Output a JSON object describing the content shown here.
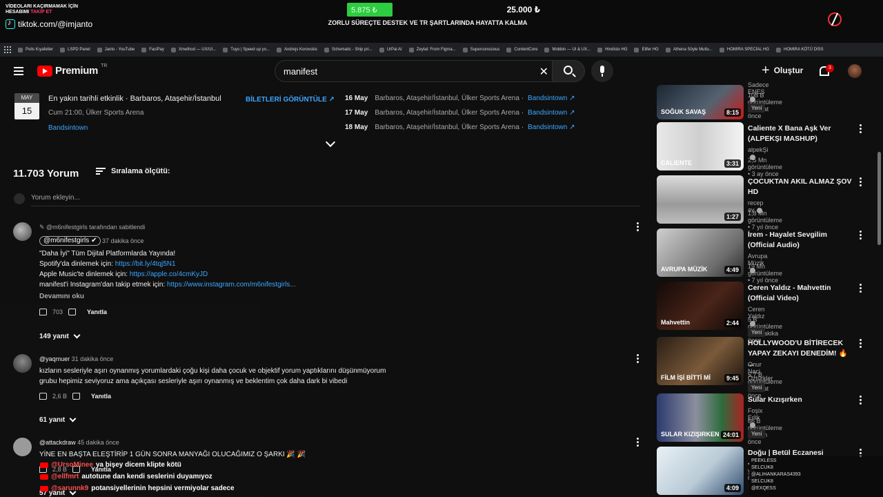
{
  "overlay": {
    "tiktok_line1": "VİDEOLARI KAÇIRMAMAK İÇİN",
    "tiktok_line2a": "HESABIMI",
    "tiktok_line2b": "TAKİP ET",
    "tiktok_handle": "tiktok.com/@imjanto",
    "donation_current": "5.875 ₺",
    "donation_goal": "25.000 ₺",
    "donation_progress": 0.235,
    "caption": "ZORLU SÜREÇTE DESTEK VE TR ŞARTLARINDA HAYATTA KALMA",
    "accent_color": "#2ecc40"
  },
  "bookmarks": [
    "Polis Kıyafetler",
    "LSPD Panel",
    "Janto - YouTube",
    "FaciPay",
    "Xmethod — UX/UI...",
    "Tuyo | Speed up yo...",
    "Andrejs Korovskis",
    "Schematic - Ship pri...",
    "UrPal AI",
    "Zeytal: From Figma...",
    "Superconscious",
    "ContentCore",
    "Mobbin — UI & UX...",
    "Hindisto HG",
    "Elifer HG",
    "Athena Söyle Mutlu...",
    "HOMIRA SPECİAL HG",
    "HOMIRA KÖTÜ DİSS"
  ],
  "header": {
    "logo_text": "Premium",
    "logo_suffix": "TR",
    "search_value": "manifest",
    "create_label": "Oluştur",
    "notification_count": "3"
  },
  "events": {
    "month": "MAY",
    "day": "15",
    "title": "En yakın tarihli etkinlik · Barbaros, Ataşehir/İstanbul",
    "subtitle": "Cum 21:00, Ülker Sports Arena",
    "source": "Bandsintown",
    "tickets_label": "BİLETLERİ GÖRÜNTÜLE ↗",
    "rows": [
      {
        "date": "16 May",
        "location": "Barbaros, Ataşehir/İstanbul, Ülker Sports Arena ·",
        "source": "Bandsintown ↗"
      },
      {
        "date": "17 May",
        "location": "Barbaros, Ataşehir/İstanbul, Ülker Sports Arena ·",
        "source": "Bandsintown ↗"
      },
      {
        "date": "18 May",
        "location": "Barbaros, Ataşehir/İstanbul, Ülker Sports Arena ·",
        "source": "Bandsintown ↗"
      }
    ]
  },
  "comments_header": {
    "count": "11.703 Yorum",
    "sort_label": "Sıralama ölçütü:",
    "add_placeholder": "Yorum ekleyin..."
  },
  "comments": {
    "pinned_by": "@m6nifestgirls tarafından sabitlendi",
    "c1": {
      "author": "@m6nifestgirls",
      "time": "37 dakika önce",
      "line1": "\"Daha İyi\" Tüm Dijital Platformlarda Yayında!",
      "line2_label": "Spotify'da dinlemek için: ",
      "line2_link": "https://bit.ly/4tqj5N1",
      "line3_label": "Apple Music'te dinlemek için: ",
      "line3_link": "https://apple.co/4cmKyJD",
      "line4_label": "manifest'i Instagram'dan takip etmek için: ",
      "line4_link": "https://www.instagram.com/m6nifestgirls...",
      "read_more": "Devamını oku",
      "likes": "703",
      "reply": "Yanıtla",
      "replies": "149 yanıt"
    },
    "c2": {
      "author": "@yaqmuer",
      "time": "31 dakika önce",
      "line1": "kızların sesleriyle aşırı oynanmış yorumlardaki çoğu kişi daha çocuk ve objektif yorum yaptıklarını düşünmüyorum",
      "line2": "grubu hepimiz seviyoruz ama açıkçası sesleriyle aşırı oynanmış ve beklentim çok daha dark bi vibedi",
      "likes": "2,6 B",
      "reply": "Yanıtla",
      "replies": "61 yanıt"
    },
    "c3": {
      "author": "@attackdraw",
      "time": "45 dakika önce",
      "line1": "YİNE EN BAŞTA ELEŞTİRİP 1 GÜN SONRA MANYAĞI OLUCAĞIMIZ O ŞARKI 🎉 🎉",
      "likes": "2,8 B",
      "reply": "Yanıtla",
      "replies": "57 yanıt"
    }
  },
  "chat": [
    {
      "user": "@UrsoMinee",
      "message": "ya bişey dicem klipte kötü"
    },
    {
      "user": "@ellfmrt",
      "message": "autotune dan kendi seslerini duyamıyoz"
    },
    {
      "user": "@sarunnk9",
      "message": "potansiyellerinin hepsini vermiyolar sadece"
    }
  ],
  "sidebar": [
    {
      "title": "",
      "channel": "Sadece ENES",
      "meta": "108 B görüntüleme • 5 saat önce",
      "badge": "Yeni",
      "duration": "8:15",
      "thumb_text": "SOĞUK SAVAŞ"
    },
    {
      "title": "Caliente X Bana Aşk Ver (ALPEKŞI MASHUP)",
      "channel": "alpekŞi",
      "meta": "2,5 Mn görüntüleme • 3 ay önce",
      "badge": "",
      "duration": "3:31",
      "thumb_text": "CALIENTE"
    },
    {
      "title": "ÇOCUKTAN AKIL ALMAZ ŞOV HD",
      "channel": "recep ay",
      "meta": "1,8 Mn görüntüleme • 7 yıl önce",
      "badge": "",
      "duration": "1:27",
      "thumb_text": ""
    },
    {
      "title": "İrem - Hayalet Sevgilim (Official Audio)",
      "channel": "Avrupa Müzik",
      "meta": "19 Mn görüntüleme • 7 yıl önce",
      "badge": "",
      "duration": "4:49",
      "thumb_text": "AVRUPA MÜZİK"
    },
    {
      "title": "Ceren Yaldız - Mahvettin (Official Video)",
      "channel": "Ceren Yaldız",
      "meta": "5 B görüntüleme • 30 dakika önce",
      "badge": "Yeni",
      "duration": "2:44",
      "thumb_text": "Mahvettin"
    },
    {
      "title": "HOLLYWOOD'U BİTİRECEK YAPAY ZEKAYI DENEDİM! 🔥 ...",
      "channel": "Onur Naci Öztürkler",
      "meta": "5,7 B görüntüleme • 5 saat önce",
      "badge": "Yeni",
      "duration": "9:45",
      "thumb_text": "FİLM İŞİ BİTTİ Mİ"
    },
    {
      "title": "Sular Kızışırken",
      "channel": "Foşix Erlik",
      "meta": "66 B görüntüleme • 1 gün önce",
      "badge": "Yeni",
      "duration": "24:01",
      "thumb_text": "SULAR KIZIŞIRKEN"
    },
    {
      "title": "Doğu | Betül Eczanesi",
      "channel": "",
      "meta": "• 2 yıl önce",
      "badge": "",
      "duration": "4:09",
      "thumb_text": ""
    }
  ],
  "mini_chat": [
    "PEEKLESS",
    "SELCUK8",
    "@ALIHANKARAS4393",
    "SELCUK8",
    "@EXQESS"
  ]
}
